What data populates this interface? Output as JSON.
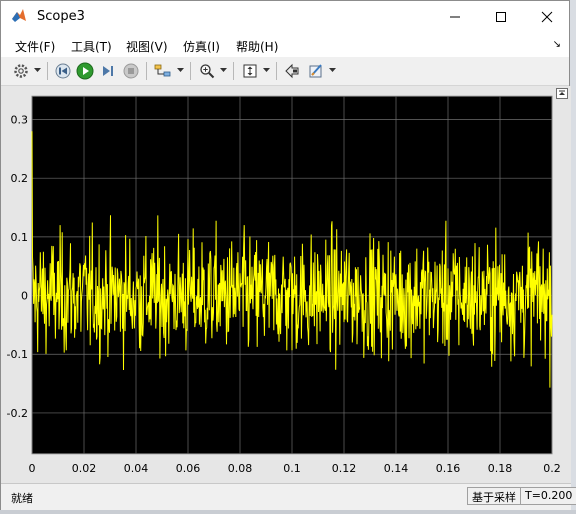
{
  "window": {
    "title": "Scope3"
  },
  "menu": [
    "文件(F)",
    "工具(T)",
    "视图(V)",
    "仿真(I)",
    "帮助(H)"
  ],
  "toolbar": [
    "settings-icon",
    "step-back-icon",
    "run-icon",
    "step-forward-icon",
    "stop-icon",
    "signal-selector-icon",
    "zoom-icon",
    "scale-axes-icon",
    "highlight-simulink-block-icon",
    "style-icon"
  ],
  "chart_data": {
    "type": "line",
    "background": "#000000",
    "line_color": "#ffff00",
    "grid": true,
    "xlim": [
      0,
      0.2
    ],
    "ylim": [
      -0.27,
      0.34
    ],
    "xticks": [
      "0",
      "0.02",
      "0.04",
      "0.06",
      "0.08",
      "0.1",
      "0.12",
      "0.14",
      "0.16",
      "0.18",
      "0.2"
    ],
    "yticks": [
      "0.3",
      "0.2",
      "0.1",
      "0",
      "-0.1",
      "-0.2"
    ],
    "sample_time": 0.0002,
    "series_range": [
      -0.23,
      0.28
    ],
    "y_start": 0.28
  },
  "status": {
    "left": "就绪",
    "mode": "基于采样",
    "time": "T=0.200"
  }
}
